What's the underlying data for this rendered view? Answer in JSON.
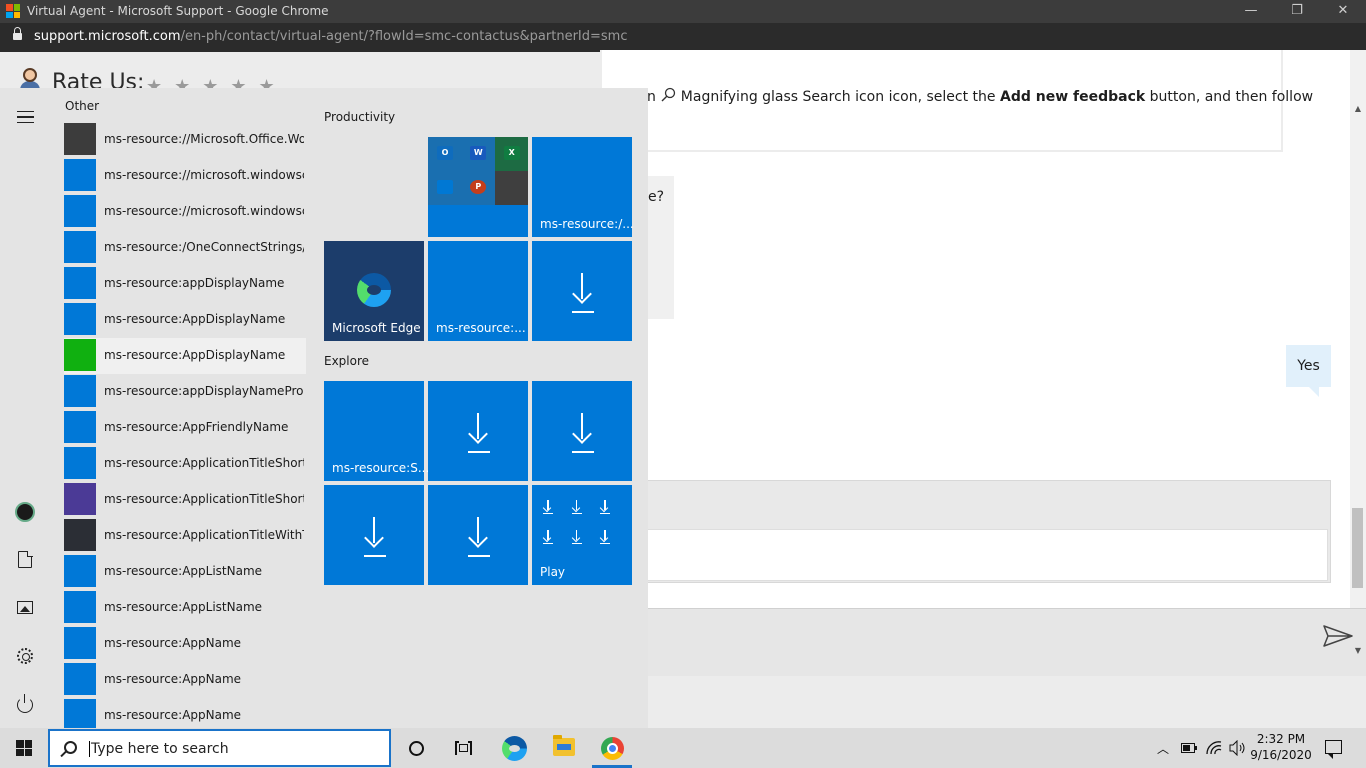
{
  "window": {
    "title": "Virtual Agent - Microsoft Support - Google Chrome",
    "minimize": "—",
    "restore": "❐",
    "close": "✕"
  },
  "address": {
    "host": "support.microsoft.com",
    "path": "/en-ph/contact/virtual-agent/?flowId=smc-contactus&partnerId=smc"
  },
  "page": {
    "rate_label": "Rate Us:",
    "stars": "★★★★★",
    "info_text_prefix": "n",
    "info_text_search": "Magnifying glass Search icon icon, select the ",
    "info_text_bold": "Add new feedback",
    "info_text_suffix": " button, and then follow",
    "bot_question_fragment": "e?",
    "user_reply": "Yes"
  },
  "start_menu": {
    "section_other": "Other",
    "apps": [
      {
        "label": "ms-resource://Microsoft.Office.Wor...",
        "color": "#3c3c3c"
      },
      {
        "label": "ms-resource://microsoft.windowsco...",
        "color": "#0078d7"
      },
      {
        "label": "ms-resource://microsoft.windowsco...",
        "color": "#0078d7"
      },
      {
        "label": "ms-resource:/OneConnectStrings/O...",
        "color": "#0078d7"
      },
      {
        "label": "ms-resource:appDisplayName",
        "color": "#0078d7"
      },
      {
        "label": "ms-resource:AppDisplayName",
        "color": "#0078d7"
      },
      {
        "label": "ms-resource:AppDisplayName",
        "color": "#10b010"
      },
      {
        "label": "ms-resource:appDisplayNamePro",
        "color": "#0078d7"
      },
      {
        "label": "ms-resource:AppFriendlyName",
        "color": "#0078d7"
      },
      {
        "label": "ms-resource:ApplicationTitleShort",
        "color": "#0078d7"
      },
      {
        "label": "ms-resource:ApplicationTitleShort",
        "color": "#4b3a96"
      },
      {
        "label": "ms-resource:ApplicationTitleWithTa...",
        "color": "#2b2e35"
      },
      {
        "label": "ms-resource:AppListName",
        "color": "#0078d7"
      },
      {
        "label": "ms-resource:AppListName",
        "color": "#0078d7"
      },
      {
        "label": "ms-resource:AppName",
        "color": "#0078d7"
      },
      {
        "label": "ms-resource:AppName",
        "color": "#0078d7"
      },
      {
        "label": "ms-resource:AppName",
        "color": "#0078d7"
      }
    ],
    "group_productivity": "Productivity",
    "group_explore": "Explore",
    "tiles": {
      "office_apps": [
        "O",
        "W",
        "X",
        "",
        "P",
        ""
      ],
      "office_colors": [
        "#0f6cbd",
        "#185abd",
        "#107c41",
        "#0078d4",
        "#c43e1c",
        "#444444"
      ],
      "tile_ms_resource_1": "ms-resource:/...",
      "edge": "Microsoft Edge",
      "tile_ms_resource_2": "ms-resource:...",
      "tile_ms_resource_3": "ms-resource:S...",
      "play": "Play"
    }
  },
  "taskbar": {
    "search_placeholder": "Type here to search",
    "time": "2:32 PM",
    "date": "9/16/2020",
    "tray_chevron": "︿"
  },
  "colors": {
    "tile_blue": "#0078d7",
    "edge_tile": "#1c3d6b",
    "accent": "#1a73c9"
  }
}
